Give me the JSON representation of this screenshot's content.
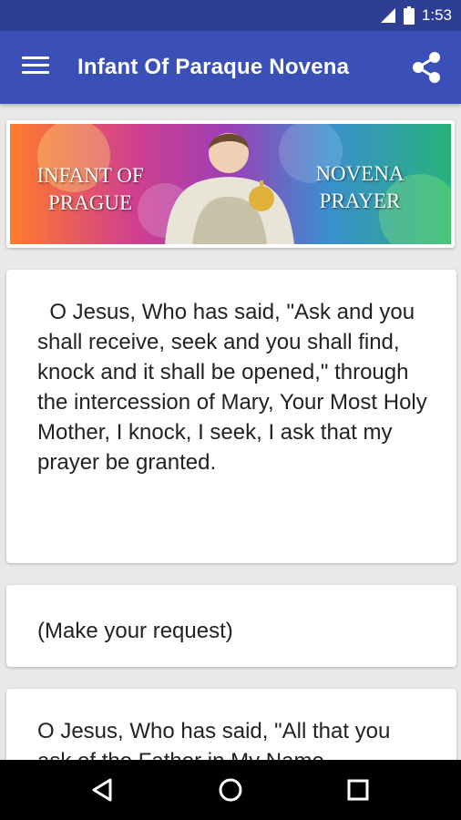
{
  "status_bar": {
    "time": "1:53",
    "icons": [
      "signal-icon",
      "battery-icon"
    ]
  },
  "app_bar": {
    "title": "Infant Of Paraque Novena",
    "menu_icon": "hamburger-menu-icon",
    "share_icon": "share-icon"
  },
  "banner": {
    "left_line1": "INFANT OF",
    "left_line2": "PRAGUE",
    "right_line1": "NOVENA",
    "right_line2": "PRAYER"
  },
  "cards": [
    {
      "text": "  O Jesus, Who has said, \"Ask and you shall receive, seek and you shall find, knock and it shall be opened,\" through the intercession of Mary, Your Most Holy Mother, I knock, I seek, I ask that my prayer be granted."
    },
    {
      "text": "(Make your request)"
    },
    {
      "text": "O Jesus, Who has said, \"All that you ask of the Father in My Name"
    }
  ],
  "nav_bar": {
    "back_icon": "back-icon",
    "home_icon": "home-icon",
    "recents_icon": "recents-icon"
  },
  "colors": {
    "status_bar": "#2e3f93",
    "app_bar": "#3a4fb8",
    "background": "#e9e9e9",
    "nav_bar": "#000000"
  }
}
